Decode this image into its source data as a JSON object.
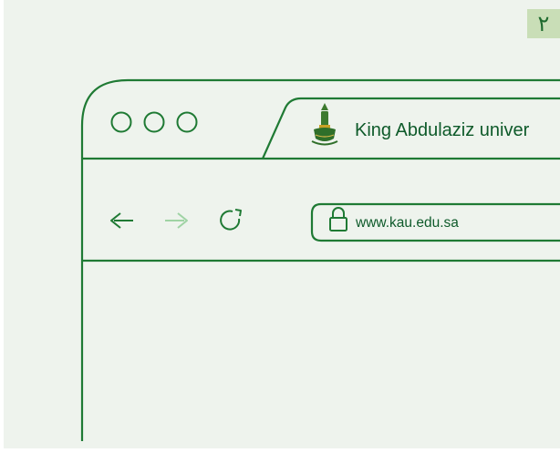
{
  "page_marker": "٢",
  "browser": {
    "tab": {
      "title": "King Abdulaziz univer",
      "favicon": "kau-emblem-icon"
    },
    "address_bar": {
      "url": "www.kau.edu.sa",
      "lock_icon": "lock-icon"
    },
    "nav": {
      "back_icon": "arrow-left-icon",
      "forward_icon": "arrow-right-icon",
      "reload_icon": "reload-icon"
    },
    "window_controls": [
      "circle-icon",
      "circle-icon",
      "circle-icon"
    ]
  },
  "colors": {
    "background": "#eef3ed",
    "stroke": "#1f7a34",
    "accent_light": "#9fd3a4",
    "text": "#0e5a2a",
    "page_marker_bg": "#c9deb7"
  }
}
